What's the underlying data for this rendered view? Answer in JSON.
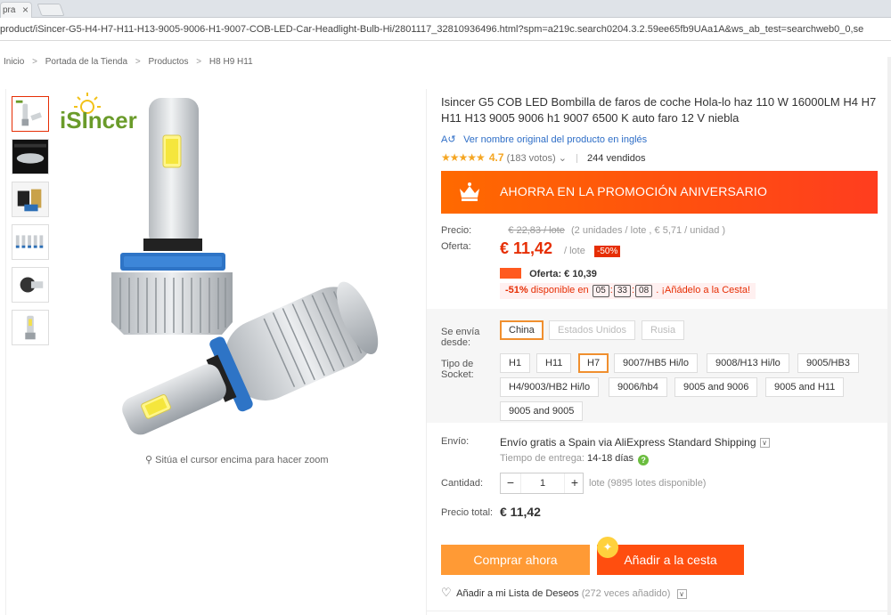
{
  "browser": {
    "tab_label": "pra",
    "url": "product/iSincer-G5-H4-H7-H11-H13-9005-9006-H1-9007-COB-LED-Car-Headlight-Bulb-Hi/2801117_32810936496.html?spm=a219c.search0204.3.2.59ee65fb9UAa1A&ws_ab_test=searchweb0_0,se"
  },
  "breadcrumb": [
    "Inicio",
    "Portada de la Tienda",
    "Productos",
    "H8 H9 H11"
  ],
  "breadcrumb_sep": ">",
  "gallery": {
    "brand_logo": "iSIncer",
    "zoom_hint": "Sitúa el cursor encima para hacer zoom",
    "thumbnail_count": 6
  },
  "product": {
    "title": "Isincer G5 COB LED Bombilla de faros de coche Hola-lo haz 110 W 16000LM H4 H7 H11 H13 9005 9006 h1 9007 6500 K auto faro 12 V niebla",
    "original_name_link": "Ver nombre original del producto en inglés",
    "rating_stars": "★★★★★",
    "rating_value": "4.7",
    "votes": "(183 votos)",
    "votes_dropdown": "⌄",
    "sold": "244 vendidos"
  },
  "promo": {
    "text": "AHORRA EN LA PROMOCIÓN ANIVERSARIO"
  },
  "pricing": {
    "price_label": "Precio:",
    "old_price": "€ 22,83 / lote",
    "old_unit_info": "(2 unidades / lote , € 5,71 / unidad )",
    "offer_label": "Oferta:",
    "offer_price": "€ 11,42",
    "offer_unit": "/ lote",
    "discount": "-50%",
    "offer2": "Oferta: € 10,39",
    "timer_pct": "-51%",
    "timer_text": "disponible en",
    "timer_h": "05",
    "timer_m": "33",
    "timer_s": "08",
    "timer_cta": ". ¡Añádelo a la Cesta!"
  },
  "options": {
    "ship_from_label": "Se envía desde:",
    "ship_from": [
      "China",
      "Estados Unidos",
      "Rusia"
    ],
    "socket_label": "Tipo de Socket:",
    "sockets": [
      "H1",
      "H11",
      "H7",
      "9007/HB5 Hi/lo",
      "9008/H13 Hi/lo",
      "9005/HB3",
      "H4/9003/HB2 Hi/lo",
      "9006/hb4",
      "9005 and 9006",
      "9005 and H11",
      "9005 and 9005"
    ],
    "selected_ship_from": "China",
    "selected_socket": "H7"
  },
  "shipping": {
    "label": "Envío:",
    "text": "Envío gratis a Spain via AliExpress Standard Shipping",
    "time_label": "Tiempo de entrega:",
    "time_value": "14-18 días"
  },
  "quantity": {
    "label": "Cantidad:",
    "minus": "−",
    "plus": "+",
    "value": "1",
    "available": "lote (9895 lotes disponible)"
  },
  "total": {
    "label": "Precio total:",
    "value": "€ 11,42"
  },
  "actions": {
    "buy_now": "Comprar ahora",
    "add_to_cart": "Añadir a la cesta",
    "wishlist": "Añadir a mi Lista de Deseos",
    "wishlist_count": "(272 veces añadido)"
  },
  "colors": {
    "accent": "#e62e04",
    "promo": "#ff5a1f",
    "buy": "#ff9a35",
    "cart": "#ff4e0f",
    "link": "#2e6ec7"
  }
}
